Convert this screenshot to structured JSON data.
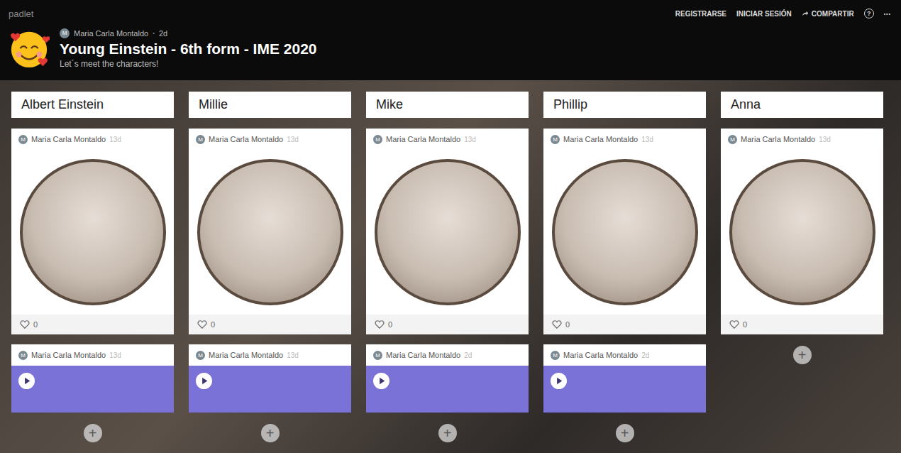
{
  "app": {
    "brand": "padlet"
  },
  "nav": {
    "links": [
      "REGISTRARSE",
      "INICIAR SESIÓN"
    ],
    "share": "COMPARTIR",
    "help": "?",
    "more": "•••"
  },
  "board": {
    "author": "Maria Carla Montaldo",
    "author_initial": "M",
    "age": "2d",
    "title": "Young Einstein - 6th form - IME 2020",
    "subtitle": "Let´s meet the characters!"
  },
  "add_button": "+",
  "columns": [
    {
      "title": "Albert Einstein",
      "posts": [
        {
          "kind": "photo",
          "author": "Maria Carla Montaldo",
          "initial": "M",
          "age": "13d",
          "likes": "0"
        },
        {
          "kind": "audio",
          "author": "Maria Carla Montaldo",
          "initial": "M",
          "age": "13d"
        }
      ]
    },
    {
      "title": "Millie",
      "posts": [
        {
          "kind": "photo",
          "author": "Maria Carla Montaldo",
          "initial": "M",
          "age": "13d",
          "likes": "0"
        },
        {
          "kind": "audio",
          "author": "Maria Carla Montaldo",
          "initial": "M",
          "age": "13d"
        }
      ]
    },
    {
      "title": "Mike",
      "posts": [
        {
          "kind": "photo",
          "author": "Maria Carla Montaldo",
          "initial": "M",
          "age": "13d",
          "likes": "0"
        },
        {
          "kind": "audio",
          "author": "Maria Carla Montaldo",
          "initial": "M",
          "age": "2d"
        }
      ]
    },
    {
      "title": "Phillip",
      "posts": [
        {
          "kind": "photo",
          "author": "Maria Carla Montaldo",
          "initial": "M",
          "age": "13d",
          "likes": "0"
        },
        {
          "kind": "audio",
          "author": "Maria Carla Montaldo",
          "initial": "M",
          "age": "2d"
        }
      ]
    },
    {
      "title": "Anna",
      "posts": [
        {
          "kind": "photo",
          "author": "Maria Carla Montaldo",
          "initial": "M",
          "age": "13d",
          "likes": "0"
        }
      ]
    }
  ]
}
